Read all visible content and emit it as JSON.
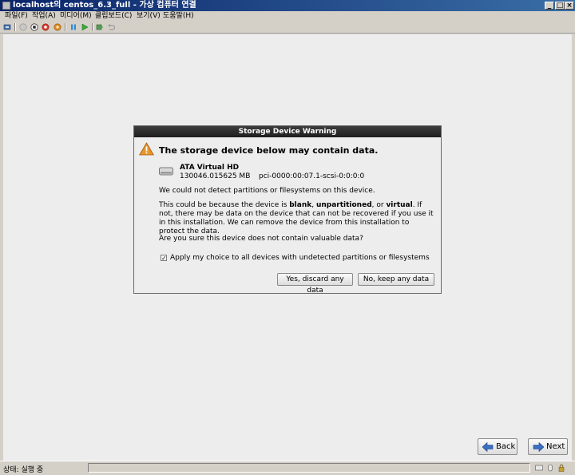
{
  "window": {
    "title": "localhost의 centos_6.3_full - 가상 컴퓨터 연결",
    "minimize_glyph": "_",
    "maximize_glyph": "□",
    "close_glyph": "×"
  },
  "menubar": {
    "items": [
      "파일(F)",
      "작업(A)",
      "미디어(M)",
      "클립보드(C)",
      "보기(V)",
      "도움말(H)"
    ]
  },
  "toolbar": {
    "buttons": [
      "ctrl-alt-del-icon",
      "start-icon",
      "turn-off-icon",
      "shutdown-icon",
      "save-icon",
      "pause-icon",
      "resume-icon",
      "snapshot-icon",
      "revert-icon"
    ]
  },
  "dialog": {
    "title": "Storage Device Warning",
    "heading": "The storage device below may contain data.",
    "device": {
      "name": "ATA Virtual HD",
      "size": "130046.015625 MB",
      "path": "pci-0000:00:07.1-scsi-0:0:0:0"
    },
    "message1": "We could not detect partitions or filesystems on this device.",
    "message2": {
      "part1": "This could be because the device is ",
      "blank": "blank",
      "sep1": ", ",
      "unpartitioned": "unpartitioned",
      "sep2": ", or ",
      "virtual": "virtual",
      "part2": ". If not, there may be data on the device that can not be recovered if you use it in this installation. We can remove the device from this installation to protect the data."
    },
    "question": "Are you sure this device does not contain valuable data?",
    "checkbox": {
      "label": "Apply my choice to all devices with undetected partitions or filesystems",
      "checked": true,
      "mark": "✓"
    },
    "yes_label": "Yes, discard any data",
    "no_label": "No, keep any data"
  },
  "nav": {
    "back_label": "Back",
    "next_label": "Next"
  },
  "statusbar": {
    "text": "상태: 실행 중"
  },
  "colors": {
    "warning": "#e8962a",
    "dialog_title_bg": "#2b2b2b",
    "screen_bg": "#ededed"
  }
}
